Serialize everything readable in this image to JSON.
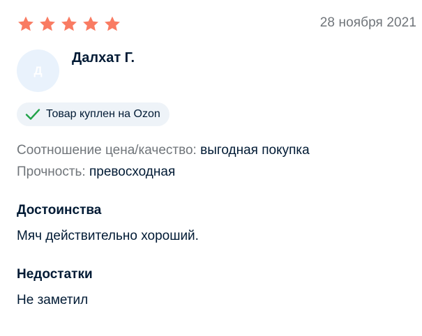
{
  "review": {
    "rating": 5,
    "rating_max": 5,
    "star_color": "#f97b62",
    "date": "28 ноября 2021",
    "author": {
      "initial": "Д",
      "name": "Далхат Г."
    },
    "badge": {
      "label": "Товар куплен на Ozon",
      "check_color": "#22a34a",
      "icon": "check-icon"
    },
    "attributes": [
      {
        "key": "Соотношение цена/качество:",
        "value": "выгодная покупка"
      },
      {
        "key": "Прочность:",
        "value": "превосходная"
      }
    ],
    "pros": {
      "title": "Достоинства",
      "text": "Мяч действительно хороший."
    },
    "cons": {
      "title": "Недостатки",
      "text": "Не заметил"
    }
  }
}
